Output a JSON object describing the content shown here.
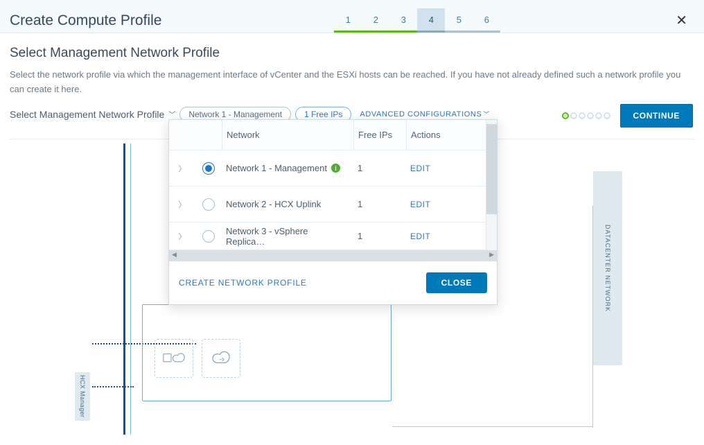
{
  "header": {
    "title": "Create Compute Profile",
    "steps": [
      "1",
      "2",
      "3",
      "4",
      "5",
      "6"
    ],
    "active_step_index": 3,
    "completed_steps": 3
  },
  "section": {
    "title": "Select Management Network Profile",
    "description": "Select the network profile via which the management interface of vCenter and the ESXi hosts can be reached. If you have not already defined such a network profile you can create it here.",
    "label": "Select Management Network Profile",
    "selected_pill": "Network 1 - Management",
    "free_ips_pill": "1 Free IPs",
    "advanced_link": "ADVANCED CONFIGURATIONS"
  },
  "actions": {
    "continue": "CONTINUE"
  },
  "dropdown": {
    "columns": {
      "network": "Network",
      "free_ips": "Free IPs",
      "actions": "Actions"
    },
    "rows": [
      {
        "name": "Network 1 - Management",
        "info": true,
        "free_ips": "1",
        "action": "EDIT",
        "selected": true
      },
      {
        "name": "Network 2 - HCX Uplink",
        "info": false,
        "free_ips": "1",
        "action": "EDIT",
        "selected": false
      },
      {
        "name": "Network 3 - vSphere Replica…",
        "info": false,
        "free_ips": "1",
        "action": "EDIT",
        "selected": false
      }
    ],
    "create_link": "CREATE NETWORK PROFILE",
    "close": "CLOSE"
  },
  "diagram": {
    "right_label": "DATACENTER NETWORK",
    "left_label": "HCX Manager"
  }
}
